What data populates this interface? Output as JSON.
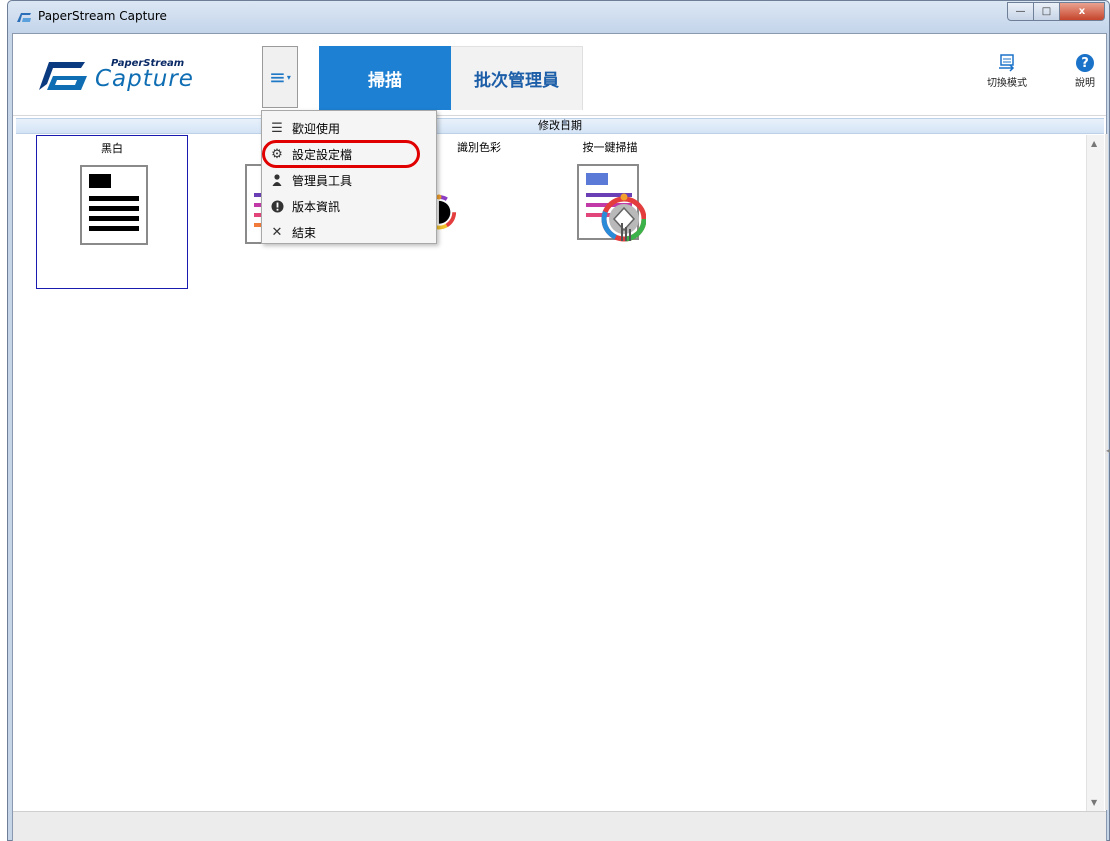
{
  "window": {
    "title": "PaperStream Capture",
    "controls": {
      "minimize": "—",
      "maximize": "□",
      "close": "x"
    }
  },
  "app": {
    "logo_small": "PaperStream",
    "logo_big": "Capture",
    "menu_button_icon": "hamburger-icon",
    "tabs": [
      {
        "label": "掃描",
        "active": true
      },
      {
        "label": "批次管理員",
        "active": false
      }
    ],
    "tools": {
      "switch_mode_label": "切換模式",
      "help_label": "說明",
      "help_glyph": "?"
    }
  },
  "list": {
    "column_header": "修改日期",
    "profiles": [
      {
        "name": "黑白",
        "selected": true,
        "icon": "bw-document-icon"
      },
      {
        "name": "",
        "selected": false,
        "icon": "color-document-icon"
      },
      {
        "name": "識別色彩",
        "selected": false,
        "icon": "auto-color-icon"
      },
      {
        "name": "按一鍵掃描",
        "selected": false,
        "icon": "one-touch-scan-icon"
      }
    ]
  },
  "menu": {
    "items": [
      {
        "label": "歡迎使用",
        "icon": "list-icon"
      },
      {
        "label": "設定設定檔",
        "icon": "gear-icon",
        "highlighted": true
      },
      {
        "label": "管理員工具",
        "icon": "person-icon"
      },
      {
        "label": "版本資訊",
        "icon": "info-icon"
      },
      {
        "label": "結束",
        "icon": "close-icon"
      }
    ]
  },
  "colors": {
    "accent": "#1d80d2",
    "highlight_ring": "#e00000",
    "selection_border": "#1a1ab0"
  }
}
